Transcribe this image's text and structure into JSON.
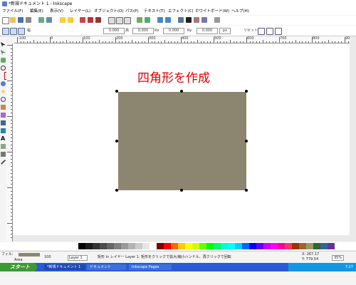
{
  "window": {
    "title": "*新規ドキュメント 1 - Inkscape"
  },
  "menu": [
    "ファイル(F)",
    "編集(E)",
    "表示(V)",
    "レイヤー(L)",
    "オブジェクト(O)",
    "パス(P)",
    "テキスト(T)",
    "エフェクト(C)",
    "ホワイトボード(W)",
    "ヘルプ(H)"
  ],
  "tool_controls": {
    "w_label": "幅",
    "w_value": "0.000",
    "h_label": "高",
    "h_value": "0.000",
    "rx_label": "Rx",
    "rx_value": "0.000",
    "ry_label": "Ry",
    "ry_value": "0.000",
    "unit": "px",
    "reset_label": "リセット"
  },
  "ruler": {
    "labels": [
      "-100",
      "0",
      "100",
      "200",
      "300",
      "400",
      "500",
      "600",
      "700",
      "800",
      "900"
    ]
  },
  "canvas": {
    "headline": "四角形を作成",
    "rect_color": "#8c8671",
    "headline_color": "#e00000"
  },
  "palette": {
    "colors": [
      "#000000",
      "#1a1a1a",
      "#333333",
      "#4d4d4d",
      "#666666",
      "#808080",
      "#999999",
      "#b3b3b3",
      "#cccccc",
      "#e6e6e6",
      "#ffffff",
      "#800000",
      "#ff0000",
      "#ff6600",
      "#ffcc00",
      "#ffff00",
      "#ccff00",
      "#66ff00",
      "#00ff00",
      "#00ff66",
      "#00ffcc",
      "#00ffff",
      "#00ccff",
      "#0066ff",
      "#0000ff",
      "#6600ff",
      "#cc00ff",
      "#ff00ff",
      "#ff0099",
      "#ff3366",
      "#993300",
      "#996633",
      "#999966",
      "#336633",
      "#336699",
      "#663399"
    ]
  },
  "status": {
    "fill_label": "フィル:",
    "fill_value": "Area",
    "opacity": "100",
    "layer": "Layer 1",
    "message": "矩形 in レイヤー Layer 1. 矩形をクリックで拡大/縮小ハンドル、再クリックで回転",
    "x": "X: 267.17",
    "y": "Y: 779.54",
    "zoom": "35%"
  },
  "taskbar": {
    "start": "スタート",
    "tasks": [
      "*新規ドキュメント 1",
      "ドキュメント",
      "Inkscape Pages"
    ],
    "clock": "7:27"
  }
}
